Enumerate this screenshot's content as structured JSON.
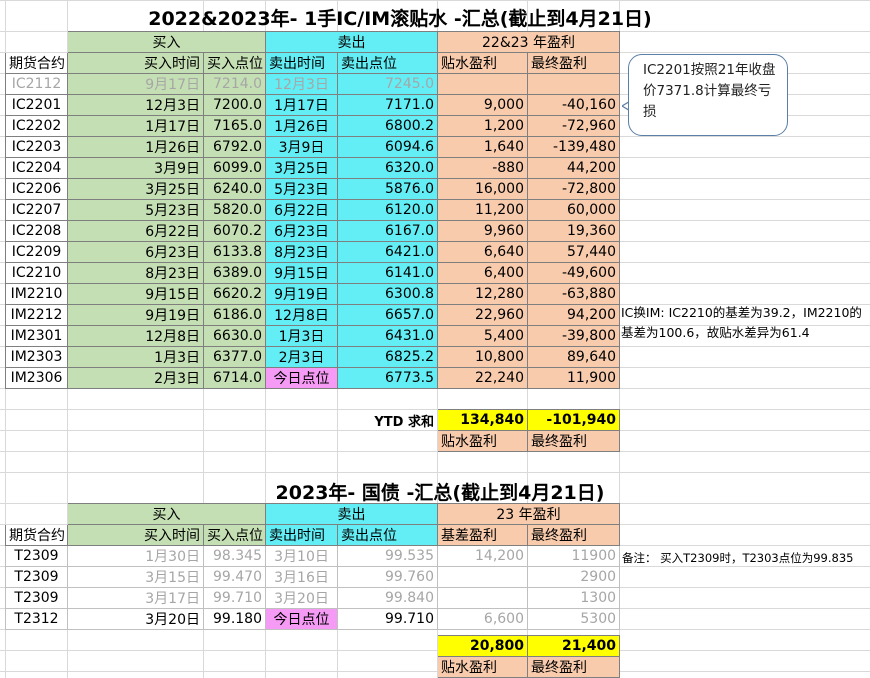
{
  "section1": {
    "title": "2022&2023年- 1手IC/IM滚贴水 -汇总(截止到4月21日)",
    "group_headers": {
      "buy": "买入",
      "sell": "卖出",
      "profit": "22&23 年盈利"
    },
    "col_headers": [
      "期货合约",
      "买入时间",
      "买入点位",
      "卖出时间",
      "卖出点位",
      "贴水盈利",
      "最终盈利"
    ],
    "rows": [
      {
        "contract": "IC2112",
        "buy_time": "9月17日",
        "buy_price": "7214.0",
        "sell_time": "12月3日",
        "sell_price": "7245.0",
        "discount_profit": "",
        "final_profit": "",
        "dim": true
      },
      {
        "contract": "IC2201",
        "buy_time": "12月3日",
        "buy_price": "7200.0",
        "sell_time": "1月17日",
        "sell_price": "7171.0",
        "discount_profit": "9,000",
        "final_profit": "-40,160"
      },
      {
        "contract": "IC2202",
        "buy_time": "1月17日",
        "buy_price": "7165.0",
        "sell_time": "1月26日",
        "sell_price": "6800.2",
        "discount_profit": "1,200",
        "final_profit": "-72,960"
      },
      {
        "contract": "IC2203",
        "buy_time": "1月26日",
        "buy_price": "6792.0",
        "sell_time": "3月9日",
        "sell_price": "6094.6",
        "discount_profit": "1,640",
        "final_profit": "-139,480"
      },
      {
        "contract": "IC2204",
        "buy_time": "3月9日",
        "buy_price": "6099.0",
        "sell_time": "3月25日",
        "sell_price": "6320.0",
        "discount_profit": "-880",
        "final_profit": "44,200"
      },
      {
        "contract": "IC2206",
        "buy_time": "3月25日",
        "buy_price": "6240.0",
        "sell_time": "5月23日",
        "sell_price": "5876.0",
        "discount_profit": "16,000",
        "final_profit": "-72,800"
      },
      {
        "contract": "IC2207",
        "buy_time": "5月23日",
        "buy_price": "5820.0",
        "sell_time": "6月22日",
        "sell_price": "6120.0",
        "discount_profit": "11,200",
        "final_profit": "60,000"
      },
      {
        "contract": "IC2208",
        "buy_time": "6月22日",
        "buy_price": "6070.2",
        "sell_time": "6月23日",
        "sell_price": "6167.0",
        "discount_profit": "9,960",
        "final_profit": "19,360"
      },
      {
        "contract": "IC2209",
        "buy_time": "6月23日",
        "buy_price": "6133.8",
        "sell_time": "8月23日",
        "sell_price": "6421.0",
        "discount_profit": "6,640",
        "final_profit": "57,440"
      },
      {
        "contract": "IC2210",
        "buy_time": "8月23日",
        "buy_price": "6389.0",
        "sell_time": "9月15日",
        "sell_price": "6141.0",
        "discount_profit": "6,400",
        "final_profit": "-49,600"
      },
      {
        "contract": "IM2210",
        "buy_time": "9月15日",
        "buy_price": "6620.2",
        "sell_time": "9月19日",
        "sell_price": "6300.8",
        "discount_profit": "12,280",
        "final_profit": "-63,880",
        "tick": true
      },
      {
        "contract": "IM2212",
        "buy_time": "9月19日",
        "buy_price": "6186.0",
        "sell_time": "12月8日",
        "sell_price": "6657.0",
        "discount_profit": "22,960",
        "final_profit": "94,200"
      },
      {
        "contract": "IM2301",
        "buy_time": "12月8日",
        "buy_price": "6630.0",
        "sell_time": "1月3日",
        "sell_price": "6431.0",
        "discount_profit": "5,400",
        "final_profit": "-39,800"
      },
      {
        "contract": "IM2303",
        "buy_time": "1月3日",
        "buy_price": "6377.0",
        "sell_time": "2月3日",
        "sell_price": "6825.2",
        "discount_profit": "10,800",
        "final_profit": "89,640"
      },
      {
        "contract": "IM2306",
        "buy_time": "2月3日",
        "buy_price": "6714.0",
        "sell_time": "今日点位",
        "sell_price": "6773.5",
        "discount_profit": "22,240",
        "final_profit": "11,900",
        "today": true
      }
    ],
    "ytd_label": "YTD 求和",
    "ytd_discount": "134,840",
    "ytd_final": "-101,940",
    "footer_labels": [
      "贴水盈利",
      "最终盈利"
    ],
    "callout": "IC2201按照21年收盘价7371.8计算最终亏损",
    "note_im": "IC换IM: IC2210的基差为39.2，IM2210的基差为100.6，故贴水差异为61.4"
  },
  "section2": {
    "title": "2023年- 国债 -汇总(截止到4月21日)",
    "group_headers": {
      "buy": "买入",
      "sell": "卖出",
      "profit": "23 年盈利"
    },
    "col_headers": [
      "期货合约",
      "买入时间",
      "买入点位",
      "卖出时间",
      "卖出点位",
      "基差盈利",
      "最终盈利"
    ],
    "rows": [
      {
        "contract": "T2309",
        "buy_time": "1月30日",
        "buy_price": "98.345",
        "sell_time": "3月10日",
        "sell_price": "99.535",
        "basis_profit": "14,200",
        "final_profit": "11900",
        "dim": true
      },
      {
        "contract": "T2309",
        "buy_time": "3月15日",
        "buy_price": "99.470",
        "sell_time": "3月16日",
        "sell_price": "99.760",
        "basis_profit": "",
        "final_profit": "2900",
        "dim": true
      },
      {
        "contract": "T2309",
        "buy_time": "3月17日",
        "buy_price": "99.710",
        "sell_time": "3月20日",
        "sell_price": "99.840",
        "basis_profit": "",
        "final_profit": "1300",
        "dim": true
      },
      {
        "contract": "T2312",
        "buy_time": "3月20日",
        "buy_price": "99.180",
        "sell_time": "今日点位",
        "sell_price": "99.710",
        "basis_profit": "6,600",
        "final_profit": "5300",
        "today": true
      }
    ],
    "sum_basis": "20,800",
    "sum_final": "21,400",
    "footer_labels": [
      "贴水盈利",
      "最终盈利"
    ],
    "note": "备注：  买入T2309时，T2303点位为99.835"
  }
}
